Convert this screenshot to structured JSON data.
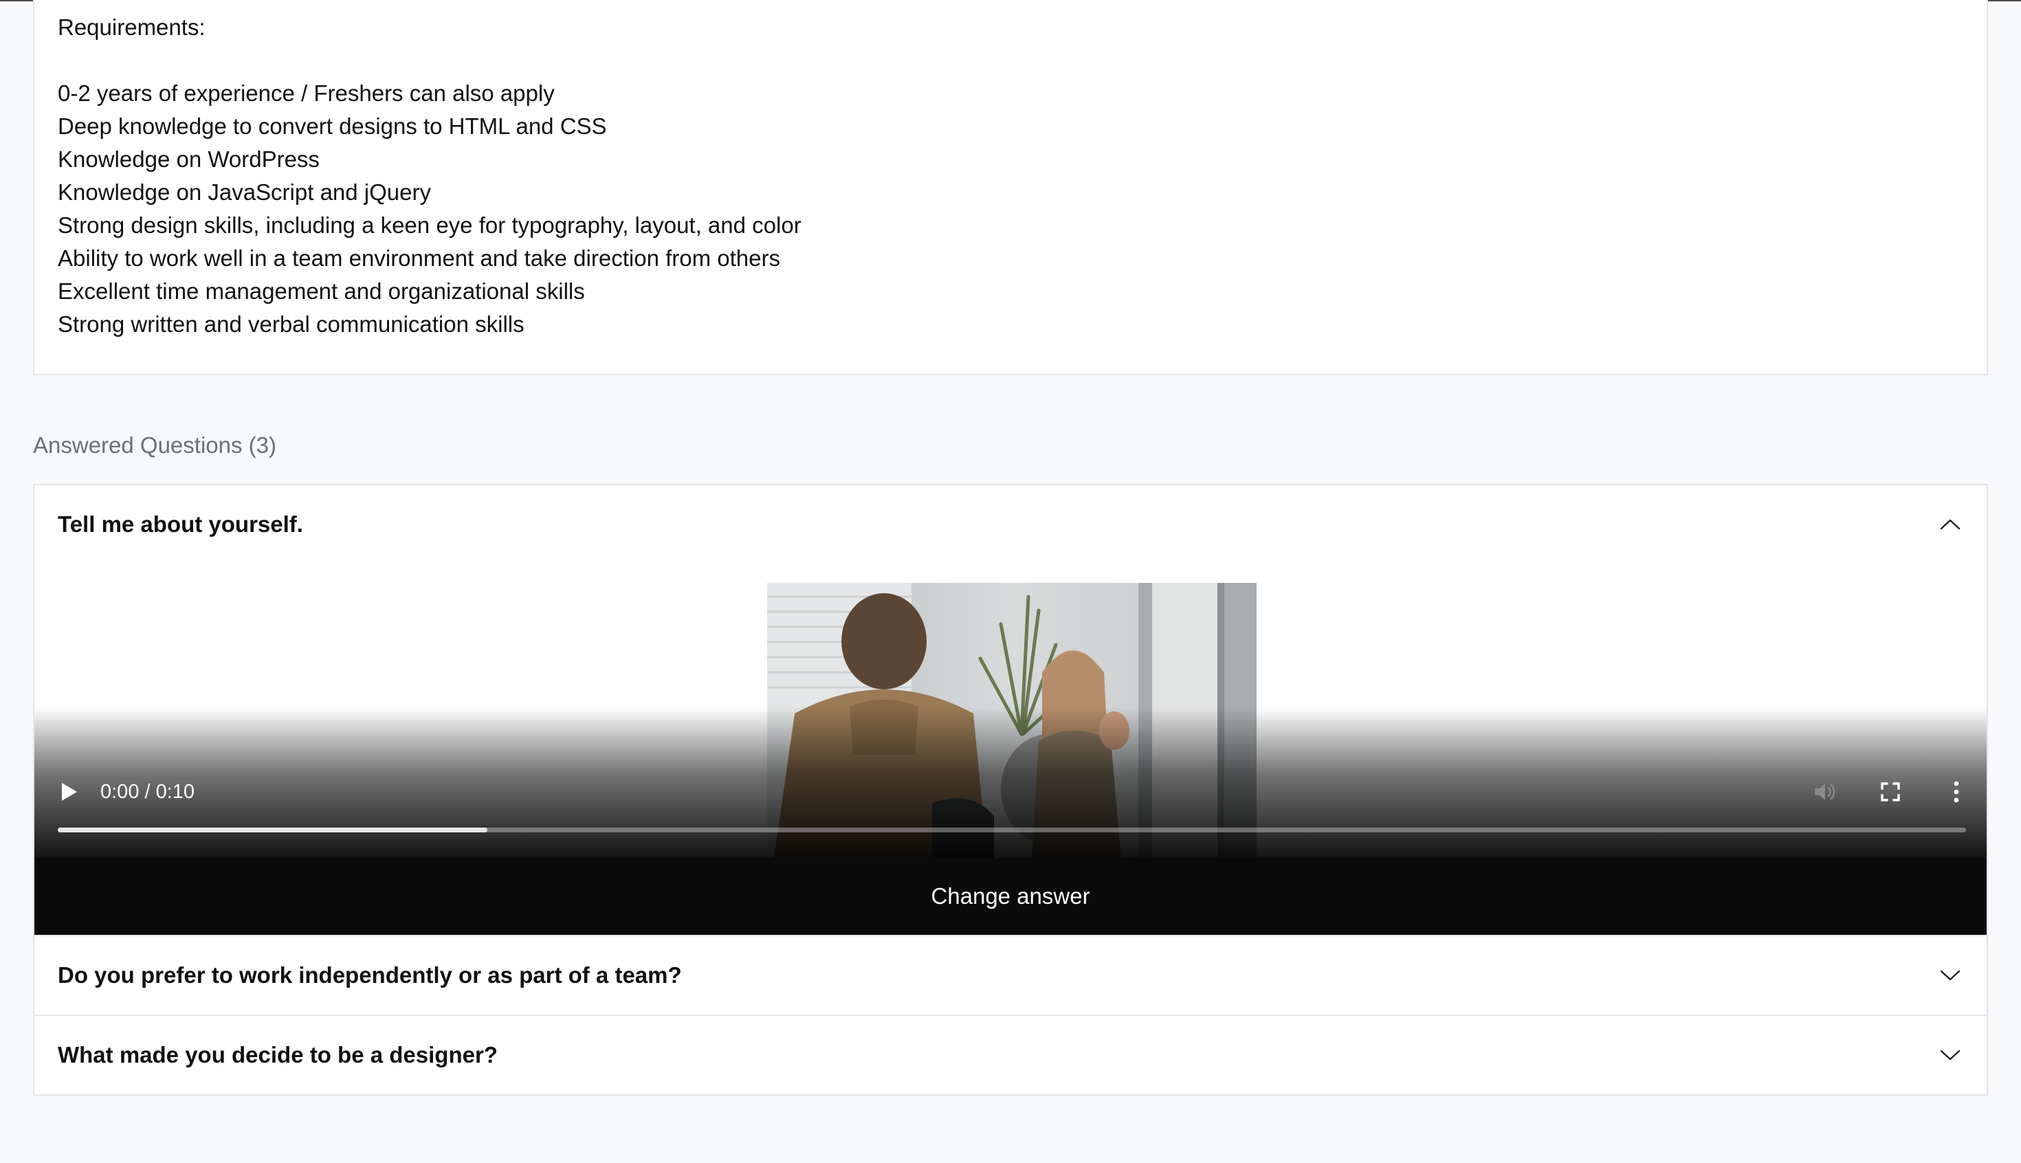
{
  "requirements": {
    "title": "Requirements:",
    "items": [
      "0-2 years of experience / Freshers can also apply",
      "Deep knowledge to convert designs to HTML and CSS",
      "Knowledge on WordPress",
      "Knowledge on JavaScript and jQuery",
      "Strong design skills, including a keen eye for typography, layout, and color",
      "Ability to work well in a team environment and take direction from others",
      "Excellent time management and organizational skills",
      "Strong written and verbal communication skills"
    ]
  },
  "answered": {
    "heading": "Answered Questions (3)",
    "questions": [
      {
        "text": "Tell me about yourself.",
        "expanded": true,
        "icon": "chevron-up-icon"
      },
      {
        "text": "Do you prefer to work independently or as part of a team?",
        "expanded": false,
        "icon": "chevron-down-icon"
      },
      {
        "text": "What made you decide to be a designer?",
        "expanded": false,
        "icon": "chevron-down-icon"
      }
    ]
  },
  "video": {
    "time": "0:00 / 0:10",
    "progress_fraction": 0.225,
    "icons": [
      "play-icon",
      "volume-icon",
      "fullscreen-icon",
      "more-options-icon"
    ]
  },
  "change_answer_label": "Change answer",
  "colors": {
    "page_bg": "#f8f9fa",
    "card_border": "#e3e5e8",
    "muted_text": "#6b7078",
    "button_bg": "#0a0a0a"
  }
}
